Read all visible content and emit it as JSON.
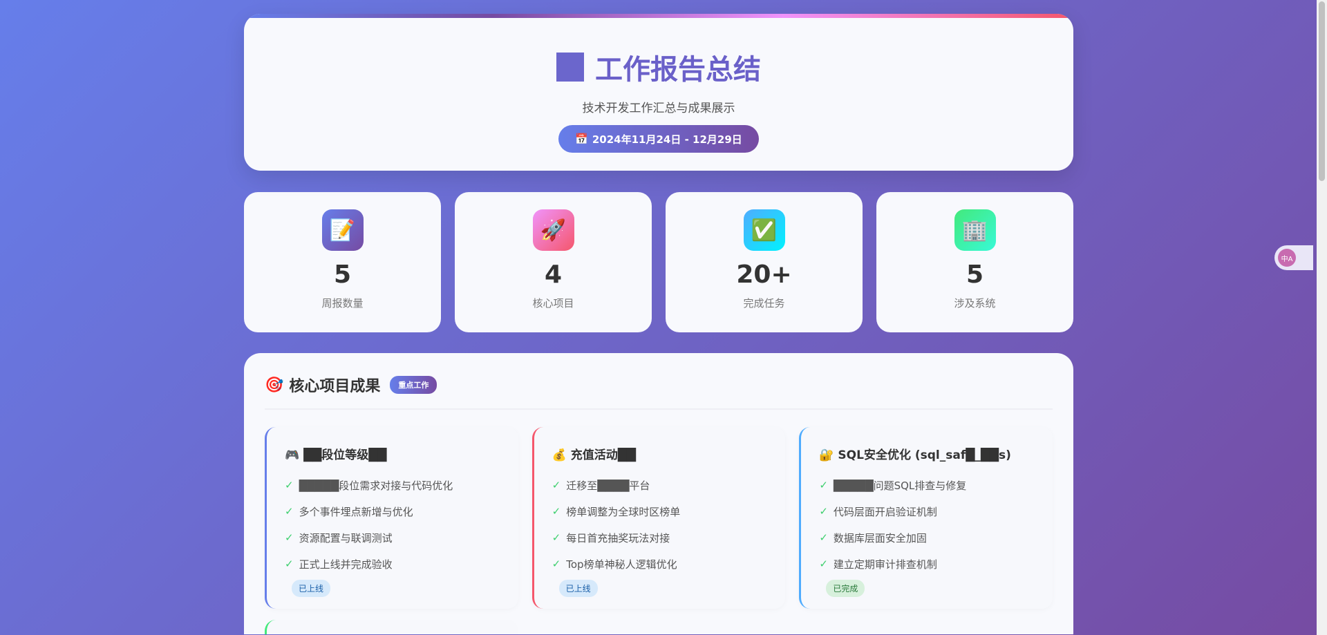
{
  "header": {
    "title": "工作报告总结",
    "subtitle": "技术开发工作汇总与成果展示",
    "date_icon": "📅",
    "date": "2024年11月24日 - 12月29日"
  },
  "stats": [
    {
      "icon": "📝",
      "value": "5",
      "label": "周报数量",
      "bg": "linear-gradient(135deg,#667eea,#764ba2)"
    },
    {
      "icon": "🚀",
      "value": "4",
      "label": "核心项目",
      "bg": "linear-gradient(135deg,#f093fb,#f5576c)"
    },
    {
      "icon": "✅",
      "value": "20+",
      "label": "完成任务",
      "bg": "linear-gradient(135deg,#4facfe,#00f2fe)"
    },
    {
      "icon": "🏢",
      "value": "5",
      "label": "涉及系统",
      "bg": "linear-gradient(135deg,#43e97b,#38f9d7)"
    }
  ],
  "section": {
    "icon": "🎯",
    "title": "核心项目成果",
    "badge": "重点工作"
  },
  "projects": [
    {
      "title": "🎮 ██段位等级██",
      "color": "#667eea",
      "items": [
        "█████段位需求对接与代码优化",
        "多个事件埋点新增与优化",
        "资源配置与联调测试",
        "正式上线并完成验收"
      ],
      "status": "已上线",
      "status_bg": "#d6e9fb",
      "status_fg": "#1a5fa8"
    },
    {
      "title": "💰 充值活动██",
      "color": "#f5576c",
      "items": [
        "迁移至████平台",
        "榜单调整为全球时区榜单",
        "每日首充抽奖玩法对接",
        "Top榜单神秘人逻辑优化"
      ],
      "status": "已上线",
      "status_bg": "#d6e9fb",
      "status_fg": "#1a5fa8"
    },
    {
      "title": "🔐 SQL安全优化 (sql_saf█_██s)",
      "color": "#4facfe",
      "items": [
        "█████问题SQL排查与修复",
        "代码层面开启验证机制",
        "数据库层面安全加固",
        "建立定期审计排查机制"
      ],
      "status": "已完成",
      "status_bg": "#d7f0dc",
      "status_fg": "#2a7a3b"
    }
  ],
  "translate_icon": "中A"
}
